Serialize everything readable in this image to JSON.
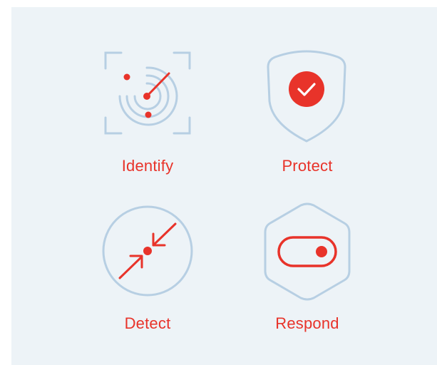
{
  "colors": {
    "panel_background": "#edf3f7",
    "accent_red": "#e8332a",
    "outline_blue": "#b7cfe3"
  },
  "functions": [
    {
      "label": "Identify",
      "icon": "radar-scan-icon"
    },
    {
      "label": "Protect",
      "icon": "shield-check-icon"
    },
    {
      "label": "Detect",
      "icon": "target-converge-icon"
    },
    {
      "label": "Respond",
      "icon": "toggle-switch-icon"
    }
  ]
}
